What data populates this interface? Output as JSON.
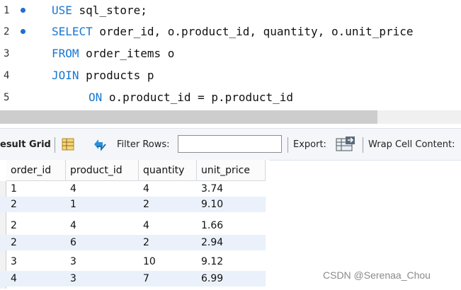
{
  "editor": {
    "lines": [
      {
        "number": "1",
        "marker": true,
        "keyword": "USE",
        "rest": " sql_store;"
      },
      {
        "number": "2",
        "marker": true,
        "keyword": "SELECT",
        "rest": " order_id, o.product_id, quantity, o.unit_price"
      },
      {
        "number": "3",
        "marker": false,
        "keyword": "FROM",
        "rest": " order_items o"
      },
      {
        "number": "4",
        "marker": false,
        "keyword": "JOIN",
        "rest": " products p"
      },
      {
        "number": "5",
        "marker": false,
        "keyword": "ON",
        "rest": " o.product_id = p.product_id"
      }
    ]
  },
  "toolbar": {
    "result_grid_label": "esult Grid",
    "filter_rows_label": "Filter Rows:",
    "filter_rows_value": "",
    "export_label": "Export:",
    "wrap_cell_label": "Wrap Cell Content:"
  },
  "grid": {
    "columns": [
      "order_id",
      "product_id",
      "quantity",
      "unit_price"
    ],
    "rows": [
      [
        "1",
        "4",
        "4",
        "3.74"
      ],
      [
        "2",
        "1",
        "2",
        "9.10"
      ],
      [
        "2",
        "4",
        "4",
        "1.66"
      ],
      [
        "2",
        "6",
        "2",
        "2.94"
      ],
      [
        "3",
        "3",
        "10",
        "9.12"
      ],
      [
        "4",
        "3",
        "7",
        "6.99"
      ]
    ]
  },
  "watermark": "CSDN @Serenaa_Chou",
  "colors": {
    "keyword": "#1577d4",
    "row_alt": "#eaf1fb",
    "marker": "#1d6fd6"
  }
}
